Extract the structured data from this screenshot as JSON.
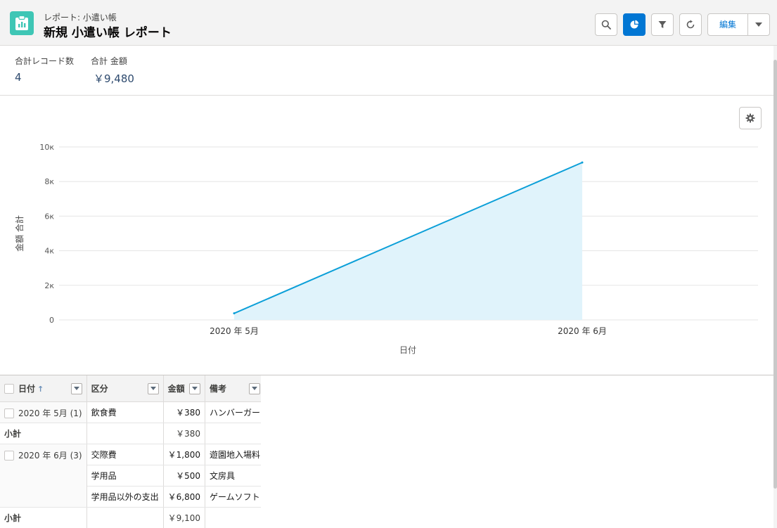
{
  "header": {
    "subtitle": "レポート: 小遣い帳",
    "title": "新規 小遣い帳 レポート",
    "edit_label": "編集"
  },
  "summary": {
    "record_count_label": "合計レコード数",
    "record_count": "4",
    "amount_label": "合計 金額",
    "amount_value": "￥9,480"
  },
  "chart_data": {
    "type": "area",
    "x": [
      "2020 年 5月",
      "2020 年 6月"
    ],
    "values": [
      380,
      9100
    ],
    "xlabel": "日付",
    "ylabel": "金額 合計",
    "ylim": [
      0,
      10000
    ],
    "yticks": [
      "0",
      "2к",
      "4к",
      "6к",
      "8к",
      "10к"
    ],
    "ytick_values": [
      0,
      2000,
      4000,
      6000,
      8000,
      10000
    ],
    "line_color": "#0b9fd8",
    "fill_color": "#e0f3fb",
    "grid": true
  },
  "table": {
    "headers": {
      "date": "日付",
      "category": "区分",
      "amount": "金額",
      "note": "備考"
    },
    "rows": {
      "g1_label": "2020 年 5月 (1)",
      "g1_r1_cat": "飲食費",
      "g1_r1_amt": "￥380",
      "g1_r1_note": "ハンバーガー",
      "subtotal_label": "小計",
      "g1_subtotal": "￥380",
      "g2_label": "2020 年 6月 (3)",
      "g2_r1_cat": "交際費",
      "g2_r1_amt": "￥1,800",
      "g2_r1_note": "遊園地入場料",
      "g2_r2_cat": "学用品",
      "g2_r2_amt": "￥500",
      "g2_r2_note": "文房具",
      "g2_r3_cat": "学用品以外の支出",
      "g2_r3_amt": "￥6,800",
      "g2_r3_note": "ゲームソフト",
      "g2_subtotal": "￥9,100"
    }
  }
}
